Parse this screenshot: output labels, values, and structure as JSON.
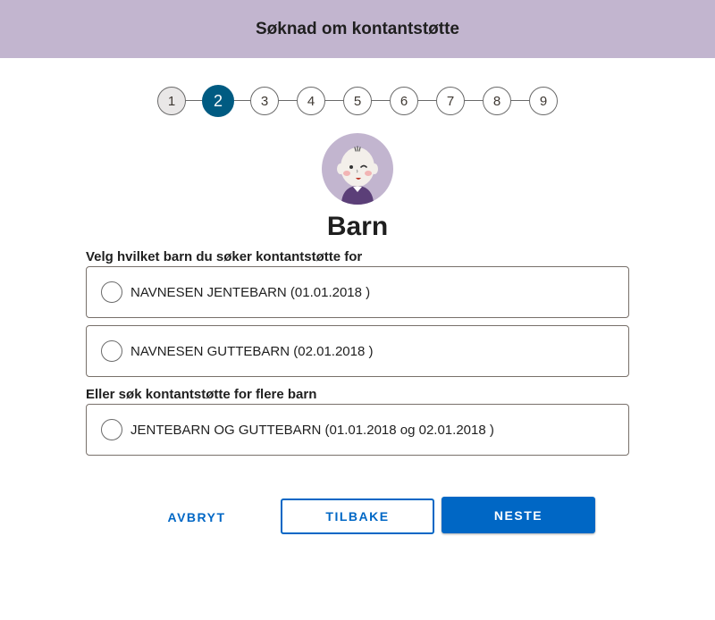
{
  "header": {
    "title": "Søknad om kontantstøtte"
  },
  "stepper": {
    "steps": [
      "1",
      "2",
      "3",
      "4",
      "5",
      "6",
      "7",
      "8",
      "9"
    ],
    "current_step": 2
  },
  "avatar": {
    "icon": "baby-illustration-icon"
  },
  "page": {
    "title": "Barn"
  },
  "single_child": {
    "legend": "Velg hvilket barn du søker kontantstøtte for",
    "options": [
      {
        "label": "NAVNESEN JENTEBARN (01.01.2018 )",
        "selected": false
      },
      {
        "label": "NAVNESEN GUTTEBARN (02.01.2018 )",
        "selected": false
      }
    ]
  },
  "multiple_children": {
    "legend": "Eller søk kontantstøtte for flere barn",
    "options": [
      {
        "label": "JENTEBARN OG GUTTEBARN (01.01.2018 og 02.01.2018 )",
        "selected": false
      }
    ]
  },
  "actions": {
    "cancel_label": "AVBRYT",
    "back_label": "TILBAKE",
    "next_label": "NESTE"
  },
  "colors": {
    "header_bg": "#c2b5cf",
    "active_step": "#005b82",
    "primary": "#0067c5"
  }
}
